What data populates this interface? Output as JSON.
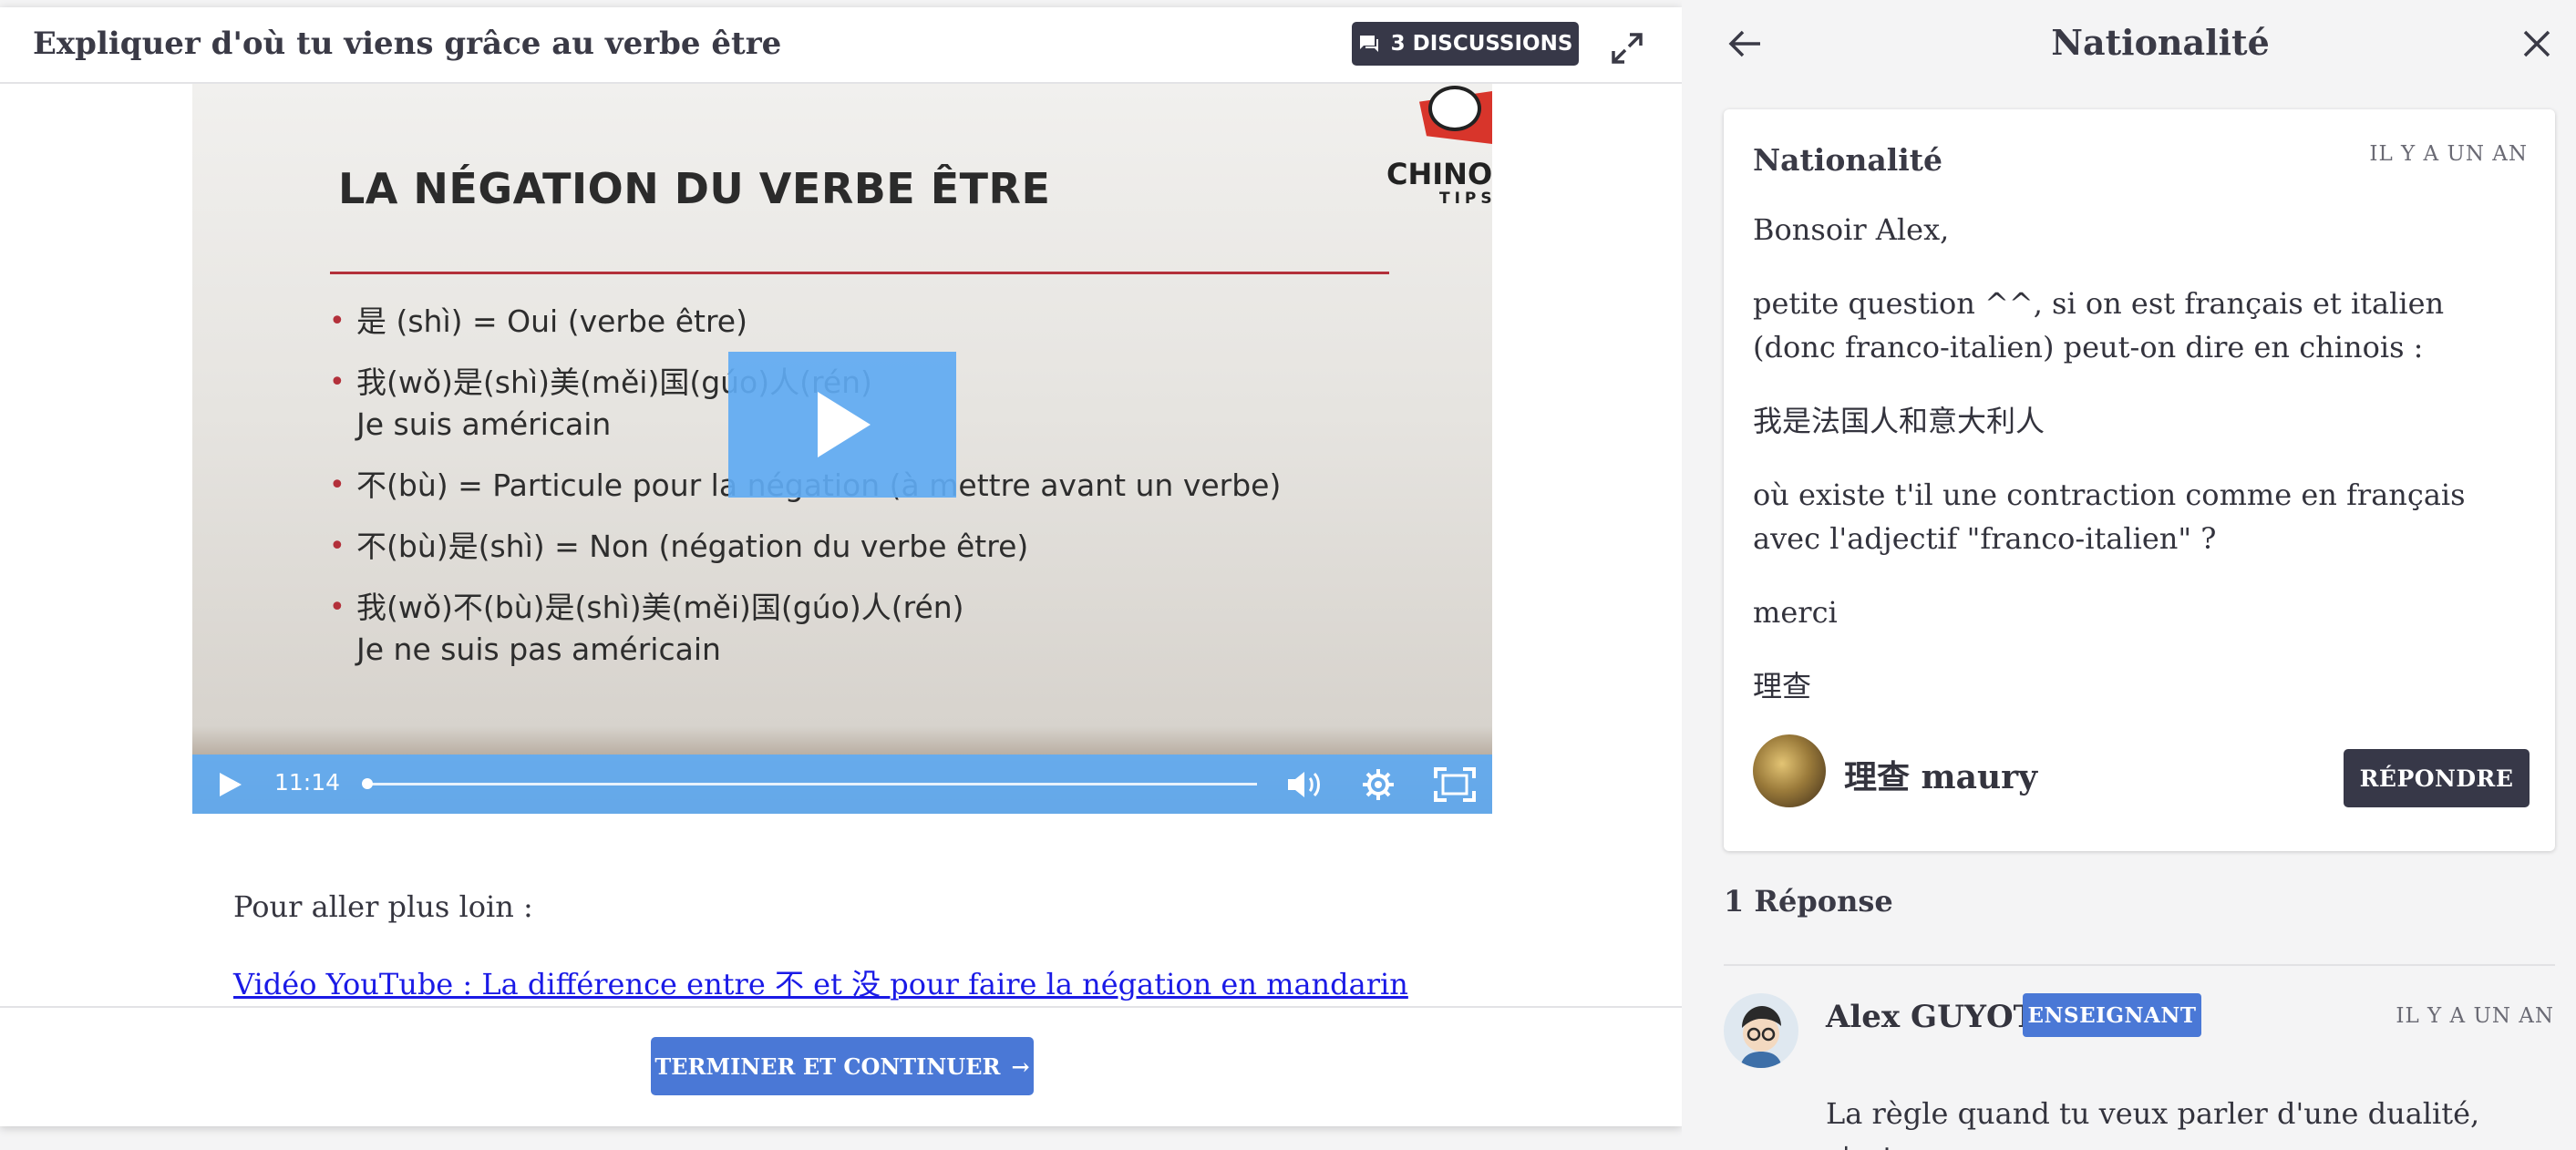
{
  "lesson": {
    "title": "Expliquer d'où tu viens grâce au verbe être",
    "discussions_label": "3 DISCUSSIONS",
    "video": {
      "slide_title": "LA NÉGATION DU VERBE ÊTRE",
      "bullets": [
        {
          "lines": [
            "是 (shì) = Oui (verbe être)"
          ]
        },
        {
          "lines": [
            "我(wǒ)是(shì)美(měi)国(gúo)人(rén)",
            "Je suis américain"
          ]
        },
        {
          "lines": [
            "不(bù) = Particule pour la négation (à mettre avant un verbe)"
          ]
        },
        {
          "lines": [
            "不(bù)是(shì) = Non (négation du verbe être)"
          ]
        },
        {
          "lines": [
            "我(wǒ)不(bù)是(shì)美(měi)国(gúo)人(rén)",
            "Je ne suis pas américain"
          ]
        }
      ],
      "logo_text": "CHINOIS",
      "logo_sub": "TIPS",
      "time": "11:14",
      "progress": 0.0,
      "accent": "#60aaf2"
    },
    "more_text": "Pour aller plus loin :",
    "youtube_link": "Vidéo YouTube : La différence entre 不 et 没 pour faire la négation en mandarin",
    "finish_label": "TERMINER ET CONTINUER",
    "finish_arrow": "→"
  },
  "sidebar": {
    "title": "Nationalité",
    "post": {
      "title": "Nationalité",
      "time": "IL Y A UN AN",
      "paragraphs": [
        "Bonsoir Alex,",
        "petite question ^^, si on est français et italien (donc franco-italien) peut-on dire en chinois :",
        "我是法国人和意大利人",
        "où existe t'il une contraction comme en français avec l'adjectif \"franco-italien\" ?",
        "merci",
        "理查"
      ],
      "author": "理查 maury",
      "reply_label": "RÉPONDRE"
    },
    "reply_count": "1 Réponse",
    "reply": {
      "author": "Alex GUYOT",
      "badge": "ENSEIGNANT",
      "time": "IL Y A UN AN",
      "text": "La règle quand tu veux parler d'une dualité, c'est"
    }
  },
  "colors": {
    "dark_button": "#373848",
    "primary": "#4a78d6",
    "link": "#1a1ae6",
    "slide_rule": "#b3303a"
  }
}
